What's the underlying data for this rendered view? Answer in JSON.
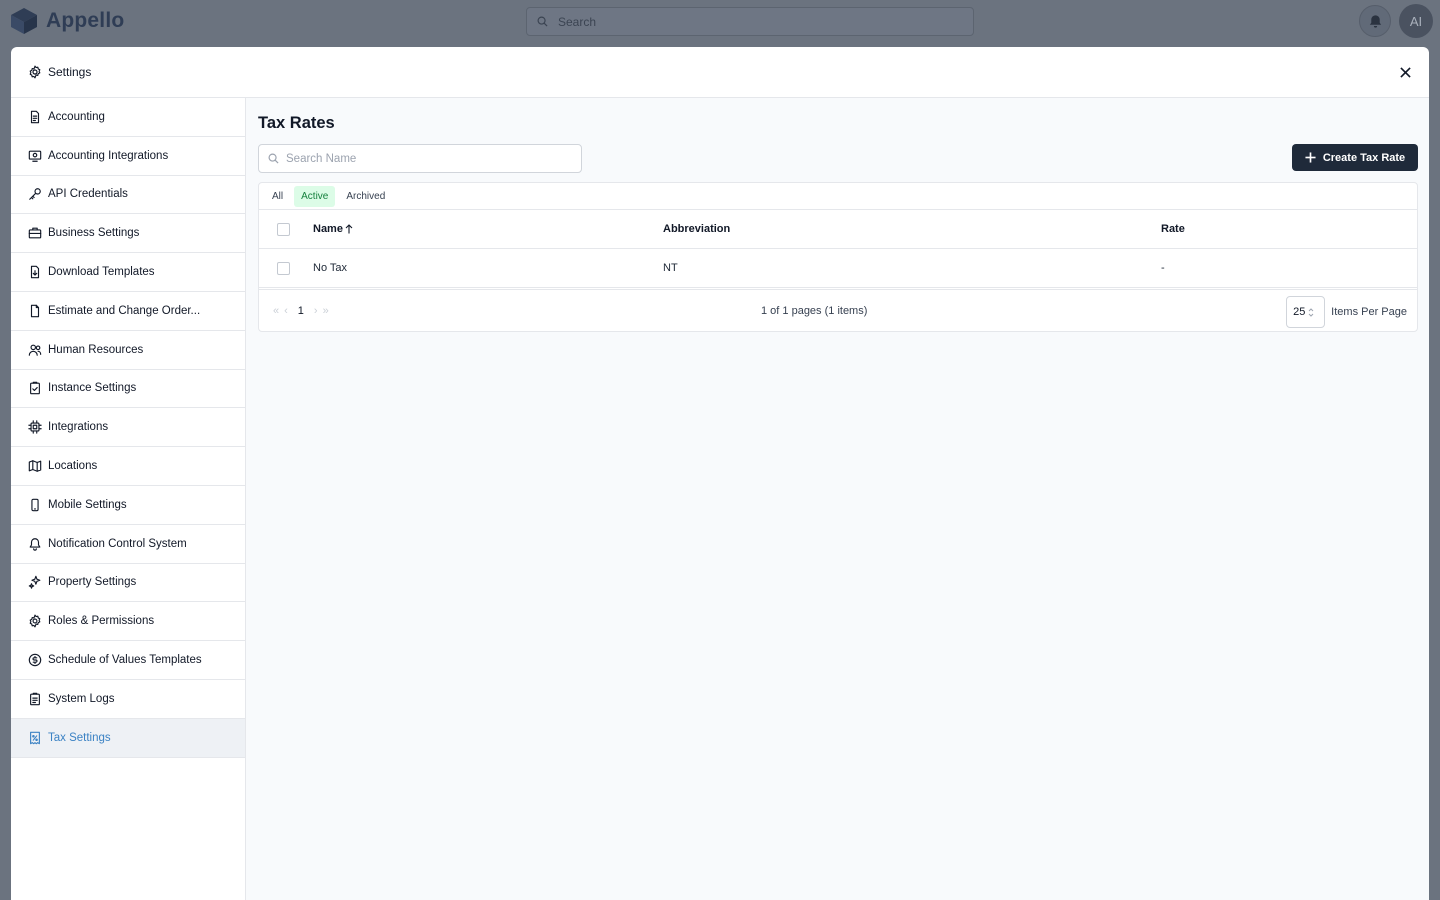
{
  "app": {
    "name": "Appello",
    "search_placeholder": "Search",
    "avatar_initials": "AI"
  },
  "modal": {
    "title": "Settings"
  },
  "sidebar": {
    "items": [
      {
        "label": "Accounting",
        "icon": "file-text-icon"
      },
      {
        "label": "Accounting Integrations",
        "icon": "monitor-dollar-icon"
      },
      {
        "label": "API Credentials",
        "icon": "key-icon"
      },
      {
        "label": "Business Settings",
        "icon": "briefcase-icon"
      },
      {
        "label": "Download Templates",
        "icon": "file-download-icon"
      },
      {
        "label": "Estimate and Change Order...",
        "icon": "file-icon"
      },
      {
        "label": "Human Resources",
        "icon": "users-icon"
      },
      {
        "label": "Instance Settings",
        "icon": "clipboard-check-icon"
      },
      {
        "label": "Integrations",
        "icon": "cpu-icon"
      },
      {
        "label": "Locations",
        "icon": "map-icon"
      },
      {
        "label": "Mobile Settings",
        "icon": "smartphone-icon"
      },
      {
        "label": "Notification Control System",
        "icon": "bell-icon"
      },
      {
        "label": "Property Settings",
        "icon": "sparkles-icon"
      },
      {
        "label": "Roles & Permissions",
        "icon": "gear-icon"
      },
      {
        "label": "Schedule of Values Templates",
        "icon": "dollar-circle-icon"
      },
      {
        "label": "System Logs",
        "icon": "clipboard-list-icon"
      },
      {
        "label": "Tax Settings",
        "icon": "receipt-percent-icon",
        "active": true
      }
    ]
  },
  "main": {
    "title": "Tax Rates",
    "search_placeholder": "Search Name",
    "create_label": "Create Tax Rate",
    "tabs": [
      {
        "label": "All"
      },
      {
        "label": "Active",
        "active": true
      },
      {
        "label": "Archived"
      }
    ],
    "table": {
      "columns": [
        "Name",
        "Abbreviation",
        "Rate"
      ],
      "rows": [
        {
          "name": "No Tax",
          "abbreviation": "NT",
          "rate": "-"
        }
      ]
    },
    "pagination": {
      "current_page": "1",
      "info": "1 of 1 pages (1 items)",
      "per_page": "25",
      "per_page_label": "Items Per Page"
    }
  },
  "colors": {
    "accent": "#3b82c4",
    "primary_button": "#1f2a3a",
    "active_tab_bg": "#dcfce7",
    "active_tab_text": "#15803d"
  }
}
